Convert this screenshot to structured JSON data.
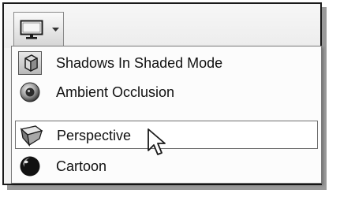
{
  "toolbar": {
    "display_button_icon": "monitor-icon",
    "dropdown_icon": "chevron-down-icon"
  },
  "menu": {
    "items": [
      {
        "label": "Shadows In Shaded Mode",
        "icon": "shadow-cube-icon",
        "state": "checked"
      },
      {
        "label": "Ambient Occlusion",
        "icon": "ambient-occlusion-icon",
        "state": "normal"
      },
      {
        "label": "Perspective",
        "icon": "perspective-box-icon",
        "state": "hover"
      },
      {
        "label": "Cartoon",
        "icon": "cartoon-sphere-icon",
        "state": "normal"
      }
    ]
  },
  "cursor": {
    "icon": "mouse-pointer-icon"
  }
}
